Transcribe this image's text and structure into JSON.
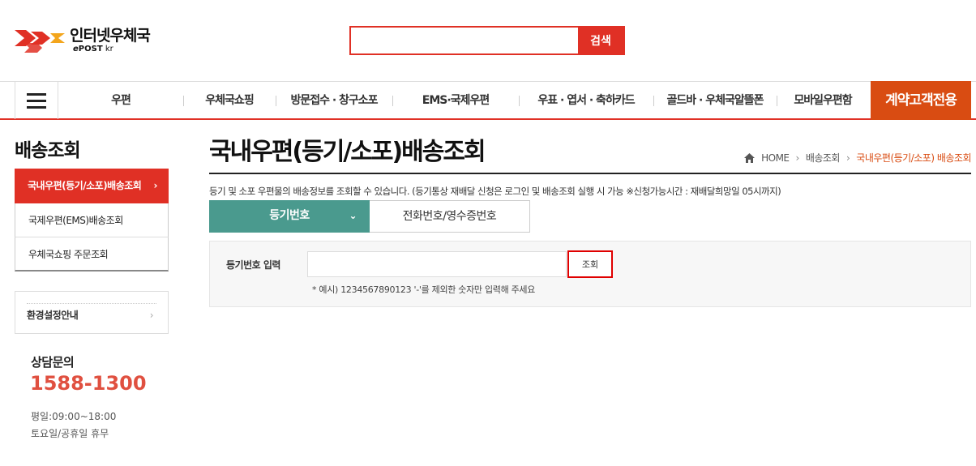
{
  "header": {
    "logo_main": "인터넷우체국",
    "logo_sub_e": "e",
    "logo_sub_post": "POST",
    "logo_sub_kr": " kr",
    "search_button": "검색",
    "search_placeholder": ""
  },
  "nav": {
    "items": [
      "우편",
      "우체국쇼핑",
      "방문접수 · 창구소포",
      "EMS·국제우편",
      "우표 · 엽서 · 축하카드",
      "골드바 · 우체국알뜰폰",
      "모바일우편함"
    ],
    "special": "계약고객전용"
  },
  "sidebar": {
    "title": "배송조회",
    "items": [
      {
        "label": "국내우편(등기/소포)배송조회",
        "active": true
      },
      {
        "label": "국제우편(EMS)배송조회"
      },
      {
        "label": "우체국쇼핑 주문조회"
      }
    ],
    "env_label": "환경설정안내",
    "cs_title": "상담문의",
    "cs_phone": "1588-1300",
    "cs_hours_weekday": "평일:09:00~18:00",
    "cs_hours_weekend": "토요일/공휴일 휴무"
  },
  "main": {
    "title": "국내우편(등기/소포)배송조회",
    "breadcrumb": {
      "home": "HOME",
      "level1": "배송조회",
      "current": "국내우편(등기/소포) 배송조회"
    },
    "description": "등기 및 소포 우편물의 배송정보를 조회할 수 있습니다. (등기통상 재배달 신청은 로그인 및 배송조회 실행 시 가능 ※신청가능시간 : 재배달희망일 05시까지)",
    "tabs": [
      "등기번호",
      "전화번호/영수증번호"
    ],
    "form": {
      "label": "등기번호 입력",
      "input_value": "",
      "button": "조회",
      "hint": "* 예시) 1234567890123 '-'를 제외한 숫자만 입력해 주세요"
    }
  },
  "colors": {
    "brand_red": "#e03025",
    "special_orange": "#d94c12",
    "tab_teal": "#4a9a8e",
    "phone_red": "#e05040"
  }
}
